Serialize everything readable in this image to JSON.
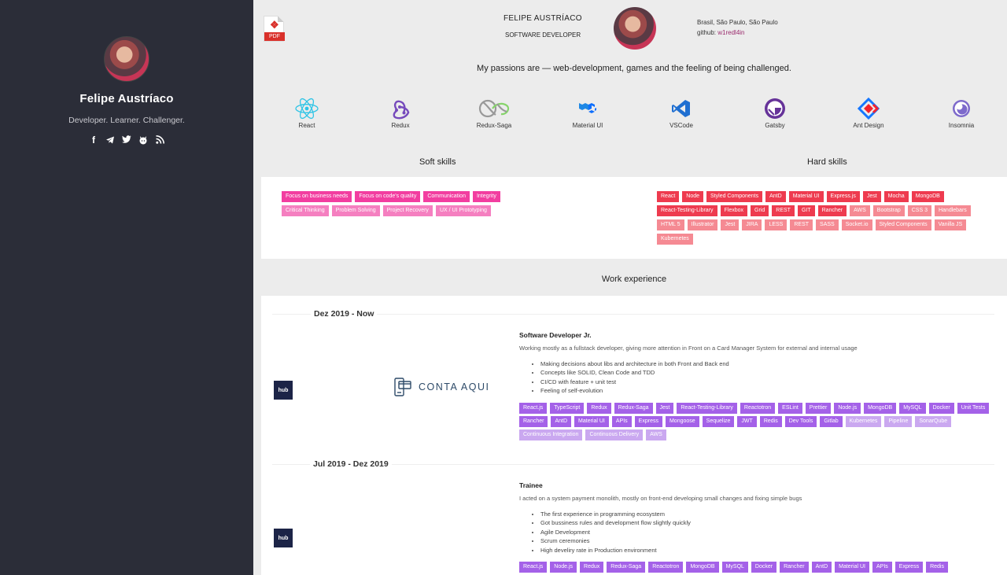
{
  "colors": {
    "sidebar_bg": "#2b2d38",
    "soft_dark": "#f23ea0",
    "soft_light": "#f57fc0",
    "hard_dark": "#ee3b4f",
    "hard_light": "#f58a93",
    "work_dark": "#a461e8",
    "work_light": "#caa8f0"
  },
  "sidebar": {
    "name": "Felipe Austríaco",
    "tagline": "Developer. Learner. Challenger.",
    "social_icons": [
      "facebook-icon",
      "telegram-icon",
      "twitter-icon",
      "github-icon",
      "rss-icon"
    ]
  },
  "header": {
    "pdf_label": "PDF",
    "name": "FELIPE AUSTRÍACO",
    "role": "SOFTWARE DEVELOPER",
    "location": "Brasil, São Paulo, São Paulo",
    "github_label": "github:",
    "github_user": "w1redl4in"
  },
  "passions": "My passions are — web-development, games and the feeling of being challenged.",
  "technologies": [
    "React",
    "Redux",
    "Redux-Saga",
    "Material UI",
    "VSCode",
    "Gatsby",
    "Ant Design",
    "Insomnia"
  ],
  "soft_skills": {
    "title": "Soft skills",
    "primary": [
      "Focus on business needs",
      "Focus on code's quality",
      "Communication",
      "Integrity"
    ],
    "secondary": [
      "Critical Thinking",
      "Problem Solving",
      "Project Recovery",
      "UX / UI Prototyping"
    ]
  },
  "hard_skills": {
    "title": "Hard skills",
    "primary": [
      "React",
      "Node",
      "Styled Components",
      "AntD",
      "Material UI",
      "Express.js",
      "Jest",
      "Mocha",
      "MongoDB",
      "React-Testing-Library",
      "Flexbox",
      "Grid",
      "REST",
      "GIT",
      "Rancher"
    ],
    "secondary": [
      "AWS",
      "Bootstrap",
      "CSS 3",
      "Handlebars",
      "HTML 5",
      "Illustrator",
      "Jest",
      "JIRA",
      "LESS",
      "REST",
      "SASS",
      "Socket.io",
      "Styled Components",
      "Vanilla JS",
      "Kubernetes"
    ]
  },
  "work": {
    "title": "Work experience",
    "jobs": [
      {
        "period": "Dez 2019 - Now",
        "company_badge": "hub",
        "company_logo_text": "CONTA AQUI",
        "title": "Software Developer Jr.",
        "description": "Working mostly as a fullstack developer, giving more attention in Front on a Card Manager System for external and internal usage",
        "bullets": [
          "Making decisions about libs and architecture in both Front and Back end",
          "Concepts like SOLID, Clean Code and TDD",
          "CI/CD with feature + unit test",
          "Feeling of self-evolution"
        ],
        "tags_primary": [
          "React.js",
          "TypeScript",
          "Redux",
          "Redux-Saga",
          "Jest",
          "React-Testing-Library",
          "Reactotron",
          "ESLint",
          "Prettier",
          "Node.js",
          "MongoDB",
          "MySQL",
          "Docker",
          "Unit Tests",
          "Rancher",
          "AntD",
          "Material UI",
          "APIs",
          "Express",
          "Mongoose",
          "Sequelize",
          "JWT",
          "Redis",
          "Dev Tools",
          "Gitlab"
        ],
        "tags_secondary": [
          "Kubernetes",
          "Pipeline",
          "SonarQube",
          "Continuous Integration",
          "Continuous Delivery",
          "AWS"
        ]
      },
      {
        "period": "Jul 2019 - Dez 2019",
        "company_badge": "hub",
        "title": "Trainee",
        "description": "I acted on a system payment monolith, mostly on front-end developing small changes and fixing simple bugs",
        "bullets": [
          "The first experience in programming ecosystem",
          "Got bussiness rules and development flow slightly quickly",
          "Agile Development",
          "Scrum ceremonies",
          "High develiry rate in Production environment"
        ],
        "tags_primary": [
          "React.js",
          "Node.js",
          "Redux",
          "Redux-Saga",
          "Reactotron",
          "MongoDB",
          "MySQL",
          "Docker",
          "Rancher",
          "AntD",
          "Material UI",
          "APIs",
          "Express",
          "Redis"
        ]
      }
    ]
  }
}
